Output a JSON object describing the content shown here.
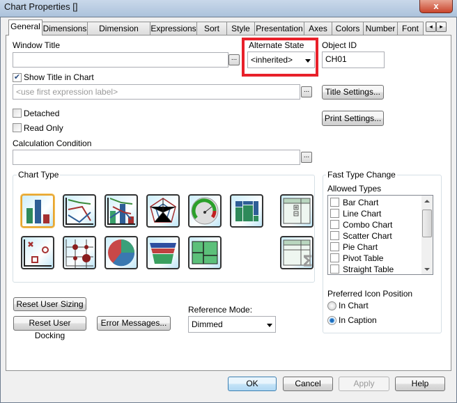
{
  "window": {
    "title": "Chart Properties []",
    "close": "x"
  },
  "tabs": [
    "General",
    "Dimensions",
    "Dimension Limits",
    "Expressions",
    "Sort",
    "Style",
    "Presentation",
    "Axes",
    "Colors",
    "Number",
    "Font"
  ],
  "tab_scroll": {
    "left": "◂",
    "right": "▸"
  },
  "general": {
    "window_title_label": "Window Title",
    "window_title_value": "",
    "dots": "...",
    "alternate_state_label": "Alternate State",
    "alternate_state_value": "<inherited>",
    "object_id_label": "Object ID",
    "object_id_value": "CH01",
    "show_title_label": "Show Title in Chart",
    "show_title_checked": true,
    "title_placeholder": "<use first expression label>",
    "title_settings": "Title Settings...",
    "print_settings": "Print Settings...",
    "detached_label": "Detached",
    "read_only_label": "Read Only",
    "calc_condition_label": "Calculation Condition",
    "calc_condition_value": "",
    "chart_type_label": "Chart Type",
    "chart_types": [
      "bar-chart",
      "line-chart",
      "combo-chart",
      "radar-chart",
      "gauge-chart",
      "mekko-chart",
      "pivot-table",
      "scatter-chart",
      "grid-chart",
      "pie-chart",
      "funnel-chart",
      "block-chart",
      "straight-table"
    ],
    "selected_chart_type": "bar-chart",
    "fast_type_change_label": "Fast Type Change",
    "allowed_types_label": "Allowed Types",
    "allowed_types": [
      {
        "label": "Bar Chart",
        "checked": false
      },
      {
        "label": "Line Chart",
        "checked": false
      },
      {
        "label": "Combo Chart",
        "checked": false
      },
      {
        "label": "Scatter Chart",
        "checked": false
      },
      {
        "label": "Pie Chart",
        "checked": false
      },
      {
        "label": "Pivot Table",
        "checked": false
      },
      {
        "label": "Straight Table",
        "checked": false
      }
    ],
    "preferred_icon_label": "Preferred Icon Position",
    "in_chart": "In Chart",
    "in_caption": "In Caption",
    "preferred_icon_selected": "In Caption",
    "reset_sizing": "Reset User Sizing",
    "reset_docking": "Reset User Docking",
    "error_messages": "Error Messages...",
    "reference_mode_label": "Reference Mode:",
    "reference_mode_value": "Dimmed"
  },
  "footer": {
    "ok": "OK",
    "cancel": "Cancel",
    "apply": "Apply",
    "help": "Help"
  },
  "colors": {
    "highlight_box": "#e8202a",
    "accent": "#3c8fd8"
  }
}
